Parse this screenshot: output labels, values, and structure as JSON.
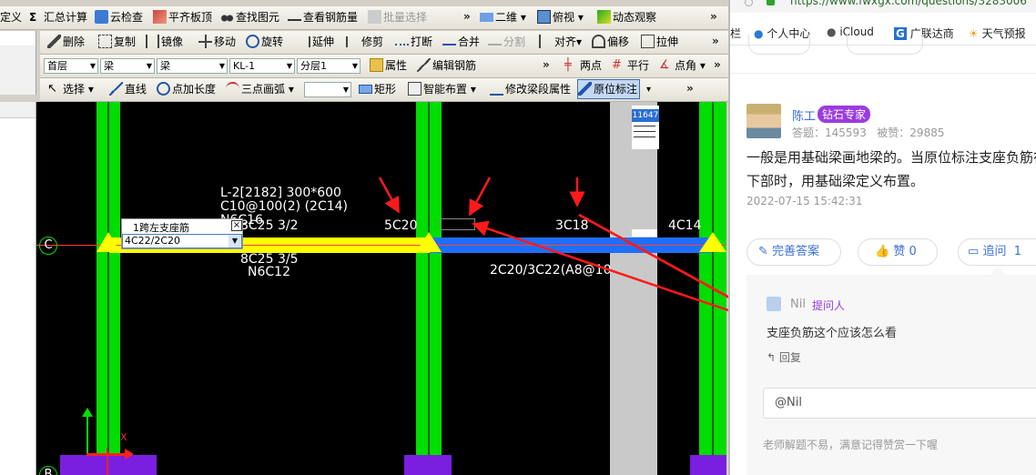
{
  "toolbar1": {
    "items": [
      "定义",
      "汇总计算",
      "云检查",
      "平齐板顶",
      "查找图元",
      "查看钢筋量",
      "批量选择"
    ],
    "sum_glyph": "Σ",
    "view_2d": "二维",
    "view_top": "俯视",
    "dynamic_view": "动态观察",
    "more": "»"
  },
  "toolbar2": {
    "items": [
      "删除",
      "复制",
      "镜像",
      "移动",
      "旋转",
      "延伸",
      "修剪",
      "打断",
      "合并",
      "分割",
      "对齐",
      "偏移",
      "拉伸"
    ],
    "more": "»",
    "panel_pin": "早",
    "panel_close": "×"
  },
  "toolbar3": {
    "floor": "首层",
    "type1": "梁",
    "type2": "梁",
    "component": "KL-1",
    "layer": "分层1",
    "props": "属性",
    "edit_rebar": "编辑钢筋",
    "more": "»",
    "two_points": "两点",
    "parallel": "平行",
    "point_angle": "点角",
    "more2": "»"
  },
  "toolbar4": {
    "select": "选择",
    "line": "直线",
    "point_length": "点加长度",
    "three_point_arc": "三点画弧",
    "empty_combo": "",
    "rect": "矩形",
    "smart_layout": "智能布置",
    "modify_span": "修改梁段属性",
    "orig_label": "原位标注",
    "more": "»"
  },
  "cad": {
    "beam_name": "L-2[2182] 300*600",
    "stirrup": "C10@100(2) (2C14)",
    "side_bars": "N6C16",
    "left_top": "8C25 3/2",
    "left_bottom": "8C25 3/5",
    "left_side": "N6C12",
    "mid_top": "5C20",
    "right_top": "3C18",
    "far_right": "4C14",
    "right_bottom": "2C20/3C22(A8@10",
    "axis_c": "C",
    "axis_b": "B",
    "dim_tag": "11647",
    "popup_title": "1跨左支座筋",
    "popup_value": "4C22/2C20",
    "popup_close": "×",
    "axis_x_mark": "X"
  },
  "browser": {
    "url": "https://www.fwxgx.com/questions/3283006",
    "bookmark_sep": "栏",
    "bookmarks": [
      "个人中心",
      "iCloud",
      "广联达商",
      "天气预报"
    ]
  },
  "answer": {
    "author": "陈工",
    "badge": "钻石专家",
    "answers_label": "答题：",
    "answers": "145593",
    "likes_label": "被赞：",
    "likes": "29885",
    "text": "一般是用基础梁画地梁的。当原位标注支座负筋在下部时，用基础梁定义布置。",
    "time": "2022-07-15 15:42:31",
    "improve": "完善答案",
    "like_btn": "赞 0",
    "followup_btn": "追问",
    "followup_count": "1"
  },
  "followup": {
    "user": "Nil",
    "role": "提问人",
    "question": "支座负筋这个应该怎么看",
    "reply": "回复",
    "input_placeholder": "@Nil",
    "hint": "老师解题不易，满意记得赞赏一下喔"
  },
  "colors": {
    "column_green": "#00dd00",
    "beam_yellow": "#ffff00",
    "beam_blue": "#1e6fff",
    "annotation_red": "#ff1a1a",
    "base_purple": "#7a1ee0",
    "link_blue": "#3a6fd8",
    "badge_purple": "#9a3ce0"
  }
}
